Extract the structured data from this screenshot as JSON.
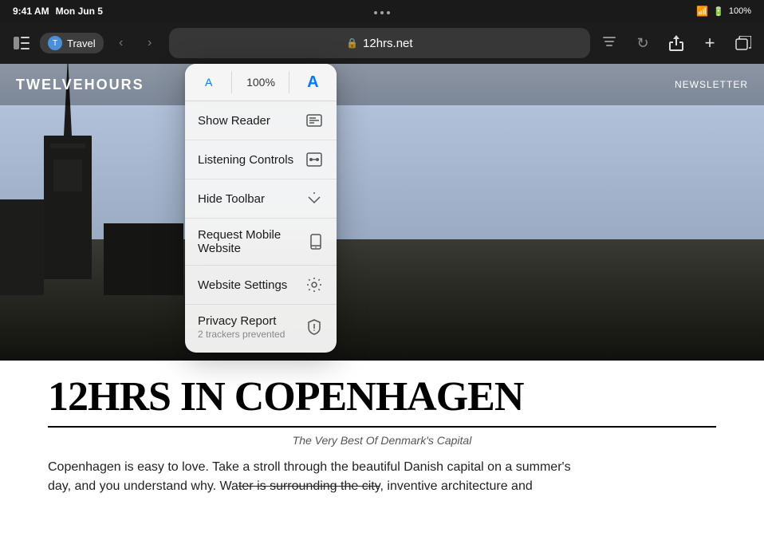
{
  "statusBar": {
    "time": "9:41 AM",
    "date": "Mon Jun 5",
    "wifi": "WiFi",
    "battery": "100%"
  },
  "toolbar": {
    "tabLabel": "Travel",
    "addressUrl": "12hrs.net",
    "lockIcon": "🔒",
    "backIcon": "‹",
    "forwardIcon": "›",
    "shareIcon": "↑",
    "addIcon": "+",
    "tabsIcon": "⧉"
  },
  "website": {
    "siteName": "TWELVEHOURS",
    "siteNav": "NEWSLETTER"
  },
  "article": {
    "title": "12HRS IN COPENHAGEN",
    "subtitle": "The Very Best Of Denmark's Capital",
    "bodyLine1": "Copenhagen is easy to love. Take a stroll through the beautiful Danish capital on a summer's",
    "bodyLine2Part1": "day, and you understand why. Wa",
    "bodyLine2Strikethrough": "ter is surrounding the city",
    "bodyLine2Part2": ", inventive architecture and"
  },
  "dropdownMenu": {
    "fontSmallLabel": "A",
    "fontSizePercent": "100%",
    "fontLargeLabel": "A",
    "items": [
      {
        "id": "show-reader",
        "label": "Show Reader",
        "sublabel": "",
        "icon": "reader"
      },
      {
        "id": "listening-controls",
        "label": "Listening Controls",
        "sublabel": "",
        "icon": "listening"
      },
      {
        "id": "hide-toolbar",
        "label": "Hide Toolbar",
        "sublabel": "",
        "icon": "hide"
      },
      {
        "id": "request-mobile",
        "label": "Request Mobile Website",
        "sublabel": "",
        "icon": "mobile"
      },
      {
        "id": "website-settings",
        "label": "Website Settings",
        "sublabel": "",
        "icon": "settings"
      },
      {
        "id": "privacy-report",
        "label": "Privacy Report",
        "sublabel": "2 trackers prevented",
        "icon": "privacy"
      }
    ]
  }
}
